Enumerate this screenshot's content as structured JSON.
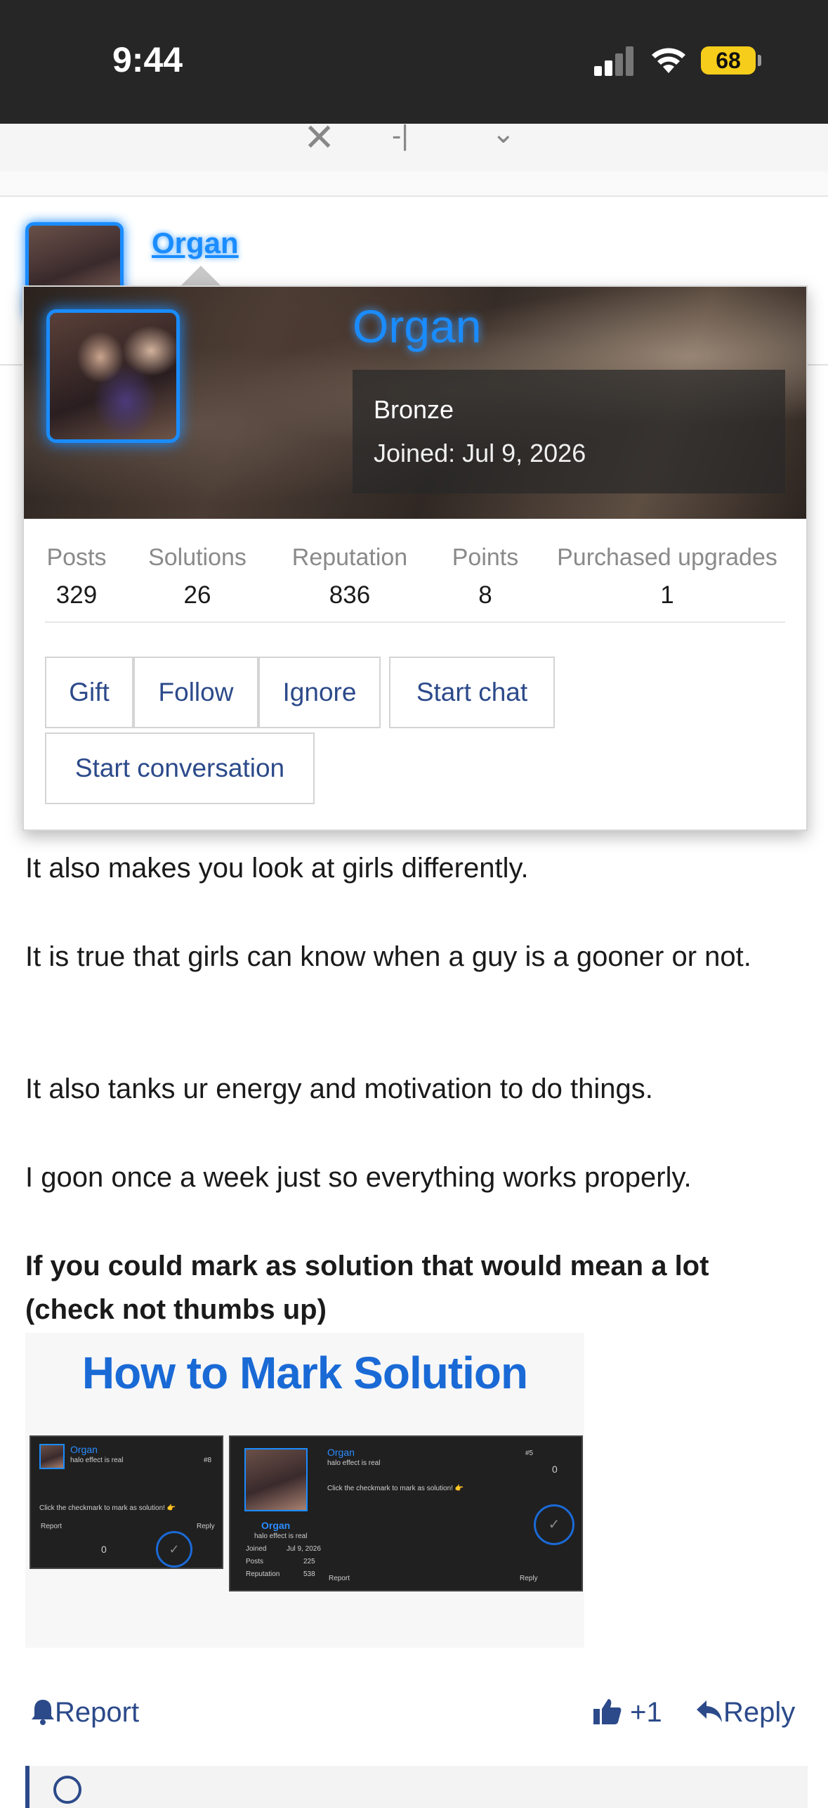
{
  "status_bar": {
    "time": "9:44",
    "battery": "68"
  },
  "post": {
    "username": "Organ"
  },
  "popup": {
    "username": "Organ",
    "rank": "Bronze",
    "joined": "Joined: Jul 9, 2026",
    "stats": [
      {
        "label": "Posts",
        "value": "329"
      },
      {
        "label": "Solutions",
        "value": "26"
      },
      {
        "label": "Reputation",
        "value": "836"
      },
      {
        "label": "Points",
        "value": "8"
      },
      {
        "label": "Purchased upgrades",
        "value": "1"
      }
    ],
    "buttons": {
      "gift": "Gift",
      "follow": "Follow",
      "ignore": "Ignore",
      "start_chat": "Start chat",
      "start_conversation": "Start conversation"
    }
  },
  "body": {
    "p1": "It also makes you look at girls differently.",
    "p2": "It is true that girls can know when a guy is a gooner or not.",
    "p3": "It also tanks ur energy and motivation to do things.",
    "p4": "I goon once a week just so everything works properly.",
    "p5": "If you could mark as solution that would mean a lot (check not thumbs up)"
  },
  "tutorial": {
    "title": "How to Mark Solution",
    "mini_username": "Organ",
    "mini_subtitle": "halo effect is real",
    "instruction": "Click the checkmark to mark as solution! 👉",
    "report": "Report",
    "reply": "Reply",
    "vote_small": "0",
    "vote_big": "0",
    "post_no_small": "#8",
    "post_no_big": "#5",
    "joined_label": "Joined",
    "joined_value": "Jul 9, 2026",
    "posts_label": "Posts",
    "posts_value": "225",
    "rep_label": "Reputation",
    "rep_value": "538"
  },
  "footer": {
    "report": "Report",
    "plus_one": "+1",
    "reply": "Reply"
  },
  "colors": {
    "accent": "#1a8cff",
    "link": "#2c4a8a",
    "status_bg": "#262626",
    "battery": "#f6cd1a"
  }
}
